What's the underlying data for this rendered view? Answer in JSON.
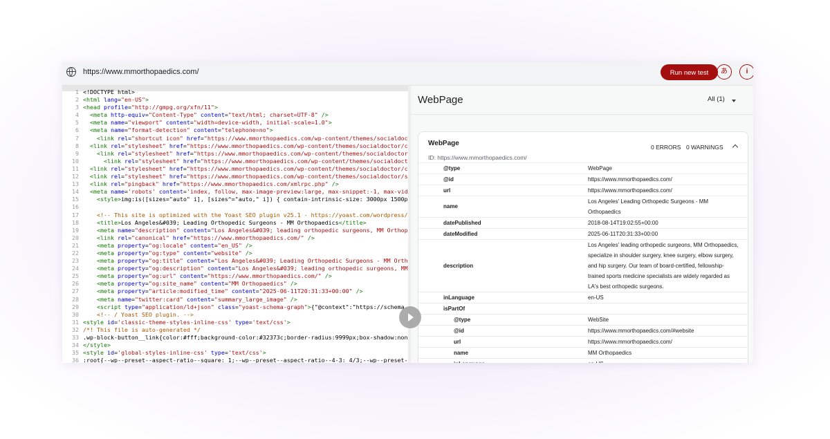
{
  "browser": {
    "url": "https://www.mmorthopaedics.com/",
    "run_button": "Run new test",
    "lang_icon_text": "あ",
    "info_icon_text": "i"
  },
  "code_lines": [
    [
      {
        "c": "",
        "t": "<!DOCTYPE html>"
      }
    ],
    [
      {
        "c": "tg",
        "t": "<html "
      },
      {
        "c": "at",
        "t": "lang"
      },
      {
        "c": "",
        "t": "="
      },
      {
        "c": "st",
        "t": "\"en-US\""
      },
      {
        "c": "tg",
        "t": ">"
      }
    ],
    [
      {
        "c": "tg",
        "t": "<head "
      },
      {
        "c": "at",
        "t": "profile"
      },
      {
        "c": "",
        "t": "="
      },
      {
        "c": "st",
        "t": "\"http://gmpg.org/xfn/11\""
      },
      {
        "c": "tg",
        "t": ">"
      }
    ],
    [
      {
        "c": "tg",
        "t": "  <meta "
      },
      {
        "c": "at",
        "t": "http-equiv"
      },
      {
        "c": "",
        "t": "="
      },
      {
        "c": "st",
        "t": "\"Content-Type\" "
      },
      {
        "c": "at",
        "t": "content"
      },
      {
        "c": "",
        "t": "="
      },
      {
        "c": "st",
        "t": "\"text/html; charset=UTF-8\" "
      },
      {
        "c": "tg",
        "t": "/>"
      }
    ],
    [
      {
        "c": "tg",
        "t": "  <meta "
      },
      {
        "c": "at",
        "t": "name"
      },
      {
        "c": "",
        "t": "="
      },
      {
        "c": "st",
        "t": "\"viewport\" "
      },
      {
        "c": "at",
        "t": "content"
      },
      {
        "c": "",
        "t": "="
      },
      {
        "c": "st",
        "t": "\"width=device-width, initial-scale=1.0\""
      },
      {
        "c": "tg",
        "t": ">"
      }
    ],
    [
      {
        "c": "tg",
        "t": "  <meta "
      },
      {
        "c": "at",
        "t": "name"
      },
      {
        "c": "",
        "t": "="
      },
      {
        "c": "st",
        "t": "\"format-detection\" "
      },
      {
        "c": "at",
        "t": "content"
      },
      {
        "c": "",
        "t": "="
      },
      {
        "c": "st",
        "t": "\"telephone=no\""
      },
      {
        "c": "tg",
        "t": ">"
      }
    ],
    [
      {
        "c": "tg",
        "t": "    <link "
      },
      {
        "c": "at",
        "t": "rel"
      },
      {
        "c": "",
        "t": "="
      },
      {
        "c": "st",
        "t": "\"shortcut icon\" "
      },
      {
        "c": "at",
        "t": "href"
      },
      {
        "c": "",
        "t": "="
      },
      {
        "c": "st",
        "t": "\"https://www.mmorthopaedics.com/wp-content/themes/socialdoctor/f"
      }
    ],
    [
      {
        "c": "tg",
        "t": "  <link "
      },
      {
        "c": "at",
        "t": "rel"
      },
      {
        "c": "",
        "t": "="
      },
      {
        "c": "st",
        "t": "\"stylesheet\" "
      },
      {
        "c": "at",
        "t": "href"
      },
      {
        "c": "",
        "t": "="
      },
      {
        "c": "st",
        "t": "\"https://www.mmorthopaedics.com/wp-content/themes/socialdoctor/css/bo"
      }
    ],
    [
      {
        "c": "tg",
        "t": "    <link "
      },
      {
        "c": "at",
        "t": "rel"
      },
      {
        "c": "",
        "t": "="
      },
      {
        "c": "st",
        "t": "\"stylesheet\" "
      },
      {
        "c": "at",
        "t": "href"
      },
      {
        "c": "",
        "t": "="
      },
      {
        "c": "st",
        "t": "\"https://www.mmorthopaedics.com/wp-content/themes/socialdoctor/css/"
      }
    ],
    [
      {
        "c": "tg",
        "t": "      <link "
      },
      {
        "c": "at",
        "t": "rel"
      },
      {
        "c": "",
        "t": "="
      },
      {
        "c": "st",
        "t": "\"stylesheet\" "
      },
      {
        "c": "at",
        "t": "href"
      },
      {
        "c": "",
        "t": "="
      },
      {
        "c": "st",
        "t": "\"https://www.mmorthopaedics.com/wp-content/themes/socialdoctor/cs"
      }
    ],
    [
      {
        "c": "tg",
        "t": "  <link "
      },
      {
        "c": "at",
        "t": "rel"
      },
      {
        "c": "",
        "t": "="
      },
      {
        "c": "st",
        "t": "\"stylesheet\" "
      },
      {
        "c": "at",
        "t": "href"
      },
      {
        "c": "",
        "t": "="
      },
      {
        "c": "st",
        "t": "\"https://www.mmorthopaedics.com/wp-content/themes/socialdoctor/css/sl"
      }
    ],
    [
      {
        "c": "tg",
        "t": "  <link "
      },
      {
        "c": "at",
        "t": "rel"
      },
      {
        "c": "",
        "t": "="
      },
      {
        "c": "st",
        "t": "\"stylesheet\" "
      },
      {
        "c": "at",
        "t": "href"
      },
      {
        "c": "",
        "t": "="
      },
      {
        "c": "st",
        "t": "\"https://www.mmorthopaedics.com/wp-content/themes/socialdoctor/style."
      }
    ],
    [
      {
        "c": "tg",
        "t": "  <link "
      },
      {
        "c": "at",
        "t": "rel"
      },
      {
        "c": "",
        "t": "="
      },
      {
        "c": "st",
        "t": "\"pingback\" "
      },
      {
        "c": "at",
        "t": "href"
      },
      {
        "c": "",
        "t": "="
      },
      {
        "c": "st",
        "t": "\"https://www.mmorthopaedics.com/xmlrpc.php\" "
      },
      {
        "c": "tg",
        "t": "/>"
      }
    ],
    [
      {
        "c": "tg",
        "t": "  <meta "
      },
      {
        "c": "at",
        "t": "name"
      },
      {
        "c": "",
        "t": "="
      },
      {
        "c": "st",
        "t": "'robots' "
      },
      {
        "c": "at",
        "t": "content"
      },
      {
        "c": "",
        "t": "="
      },
      {
        "c": "st",
        "t": "'index, follow, max-image-preview:large, max-snippet:-1, max-video-pr"
      }
    ],
    [
      {
        "c": "tg",
        "t": "    <style>"
      },
      {
        "c": "",
        "t": "img:is([sizes=\"auto\" i], [sizes^=\"auto,\" i]) { contain-intrinsic-size: 3000px 1500px }"
      },
      {
        "c": "tg",
        "t": "</"
      }
    ],
    [
      {
        "c": "",
        "t": ""
      }
    ],
    [
      {
        "c": "cm",
        "t": "    <!-- This site is optimized with the Yoast SEO plugin v25.1 - https://yoast.com/wordpress/plugi"
      }
    ],
    [
      {
        "c": "tg",
        "t": "    <title>"
      },
      {
        "c": "",
        "t": "Los Angeles&#039; Leading Orthopedic Surgeons - MM Orthopaedics"
      },
      {
        "c": "tg",
        "t": "</title>"
      }
    ],
    [
      {
        "c": "tg",
        "t": "    <meta "
      },
      {
        "c": "at",
        "t": "name"
      },
      {
        "c": "",
        "t": "="
      },
      {
        "c": "st",
        "t": "\"description\" "
      },
      {
        "c": "at",
        "t": "content"
      },
      {
        "c": "",
        "t": "="
      },
      {
        "c": "st",
        "t": "\"Los Angeles&#039; leading orthopedic surgeons, MM Orthopaedic"
      }
    ],
    [
      {
        "c": "tg",
        "t": "    <link "
      },
      {
        "c": "at",
        "t": "rel"
      },
      {
        "c": "",
        "t": "="
      },
      {
        "c": "st",
        "t": "\"canonical\" "
      },
      {
        "c": "at",
        "t": "href"
      },
      {
        "c": "",
        "t": "="
      },
      {
        "c": "st",
        "t": "\"https://www.mmorthopaedics.com/\" "
      },
      {
        "c": "tg",
        "t": "/>"
      }
    ],
    [
      {
        "c": "tg",
        "t": "    <meta "
      },
      {
        "c": "at",
        "t": "property"
      },
      {
        "c": "",
        "t": "="
      },
      {
        "c": "st",
        "t": "\"og:locale\" "
      },
      {
        "c": "at",
        "t": "content"
      },
      {
        "c": "",
        "t": "="
      },
      {
        "c": "st",
        "t": "\"en_US\" "
      },
      {
        "c": "tg",
        "t": "/>"
      }
    ],
    [
      {
        "c": "tg",
        "t": "    <meta "
      },
      {
        "c": "at",
        "t": "property"
      },
      {
        "c": "",
        "t": "="
      },
      {
        "c": "st",
        "t": "\"og:type\" "
      },
      {
        "c": "at",
        "t": "content"
      },
      {
        "c": "",
        "t": "="
      },
      {
        "c": "st",
        "t": "\"website\" "
      },
      {
        "c": "tg",
        "t": "/>"
      }
    ],
    [
      {
        "c": "tg",
        "t": "    <meta "
      },
      {
        "c": "at",
        "t": "property"
      },
      {
        "c": "",
        "t": "="
      },
      {
        "c": "st",
        "t": "\"og:title\" "
      },
      {
        "c": "at",
        "t": "content"
      },
      {
        "c": "",
        "t": "="
      },
      {
        "c": "st",
        "t": "\"Los Angeles&#039; Leading Orthopedic Surgeons - MM Orthopae"
      }
    ],
    [
      {
        "c": "tg",
        "t": "    <meta "
      },
      {
        "c": "at",
        "t": "property"
      },
      {
        "c": "",
        "t": "="
      },
      {
        "c": "st",
        "t": "\"og:description\" "
      },
      {
        "c": "at",
        "t": "content"
      },
      {
        "c": "",
        "t": "="
      },
      {
        "c": "st",
        "t": "\"Los Angeles&#039; leading orthopedic surgeons, MM Orth"
      }
    ],
    [
      {
        "c": "tg",
        "t": "    <meta "
      },
      {
        "c": "at",
        "t": "property"
      },
      {
        "c": "",
        "t": "="
      },
      {
        "c": "st",
        "t": "\"og:url\" "
      },
      {
        "c": "at",
        "t": "content"
      },
      {
        "c": "",
        "t": "="
      },
      {
        "c": "st",
        "t": "\"https://www.mmorthopaedics.com/\" "
      },
      {
        "c": "tg",
        "t": "/>"
      }
    ],
    [
      {
        "c": "tg",
        "t": "    <meta "
      },
      {
        "c": "at",
        "t": "property"
      },
      {
        "c": "",
        "t": "="
      },
      {
        "c": "st",
        "t": "\"og:site_name\" "
      },
      {
        "c": "at",
        "t": "content"
      },
      {
        "c": "",
        "t": "="
      },
      {
        "c": "st",
        "t": "\"MM Orthopaedics\" "
      },
      {
        "c": "tg",
        "t": "/>"
      }
    ],
    [
      {
        "c": "tg",
        "t": "    <meta "
      },
      {
        "c": "at",
        "t": "property"
      },
      {
        "c": "",
        "t": "="
      },
      {
        "c": "st",
        "t": "\"article:modified_time\" "
      },
      {
        "c": "at",
        "t": "content"
      },
      {
        "c": "",
        "t": "="
      },
      {
        "c": "st",
        "t": "\"2025-06-11T20:31:33+00:00\" "
      },
      {
        "c": "tg",
        "t": "/>"
      }
    ],
    [
      {
        "c": "tg",
        "t": "    <meta "
      },
      {
        "c": "at",
        "t": "name"
      },
      {
        "c": "",
        "t": "="
      },
      {
        "c": "st",
        "t": "\"twitter:card\" "
      },
      {
        "c": "at",
        "t": "content"
      },
      {
        "c": "",
        "t": "="
      },
      {
        "c": "st",
        "t": "\"summary_large_image\" "
      },
      {
        "c": "tg",
        "t": "/>"
      }
    ],
    [
      {
        "c": "tg",
        "t": "    <script "
      },
      {
        "c": "at",
        "t": "type"
      },
      {
        "c": "",
        "t": "="
      },
      {
        "c": "st",
        "t": "\"application/ld+json\" "
      },
      {
        "c": "at",
        "t": "class"
      },
      {
        "c": "",
        "t": "="
      },
      {
        "c": "st",
        "t": "\"yoast-schema-graph\""
      },
      {
        "c": "tg",
        "t": ">"
      },
      {
        "c": "",
        "t": "{\"@context\":\"https://schema.org\""
      }
    ],
    [
      {
        "c": "cm",
        "t": "    <!-- / Yoast SEO plugin. -->"
      }
    ],
    [
      {
        "c": "tg",
        "t": "<style "
      },
      {
        "c": "at",
        "t": "id"
      },
      {
        "c": "",
        "t": "="
      },
      {
        "c": "st",
        "t": "'classic-theme-styles-inline-css' "
      },
      {
        "c": "at",
        "t": "type"
      },
      {
        "c": "",
        "t": "="
      },
      {
        "c": "st",
        "t": "'text/css'"
      },
      {
        "c": "tg",
        "t": ">"
      }
    ],
    [
      {
        "c": "cm",
        "t": "/*! This file is auto-generated */"
      }
    ],
    [
      {
        "c": "",
        "t": ".wp-block-button__link{color:#fff;background-color:#32373c;border-radius:9999px;box-shadow:none;tex"
      }
    ],
    [
      {
        "c": "tg",
        "t": "</style>"
      }
    ],
    [
      {
        "c": "tg",
        "t": "<style "
      },
      {
        "c": "at",
        "t": "id"
      },
      {
        "c": "",
        "t": "="
      },
      {
        "c": "st",
        "t": "'global-styles-inline-css' "
      },
      {
        "c": "at",
        "t": "type"
      },
      {
        "c": "",
        "t": "="
      },
      {
        "c": "st",
        "t": "'text/css'"
      },
      {
        "c": "tg",
        "t": ">"
      }
    ],
    [
      {
        "c": "",
        "t": ":root{--wp--preset--aspect-ratio--square: 1;--wp--preset--aspect-ratio--4-3: 4/3;--wp--preset--as"
      }
    ]
  ],
  "panel": {
    "title": "WebPage",
    "filter": "All (1)",
    "card": {
      "title": "WebPage",
      "id_line": "ID: https://www.mmorthopaedics.com/",
      "errors": "0 ERRORS",
      "warnings": "0 WARNINGS",
      "rows": [
        {
          "key": "@type",
          "value": "WebPage",
          "indent": false,
          "lines": 1
        },
        {
          "key": "@id",
          "value": "https://www.mmorthopaedics.com/",
          "indent": false,
          "lines": 1
        },
        {
          "key": "url",
          "value": "https://www.mmorthopaedics.com/",
          "indent": false,
          "lines": 1
        },
        {
          "key": "name",
          "value": "Los Angeles' Leading Orthopedic Surgeons - MM Orthopaedics",
          "indent": false,
          "lines": 2
        },
        {
          "key": "datePublished",
          "value": "2018-08-14T19:02:55+00:00",
          "indent": false,
          "lines": 1
        },
        {
          "key": "dateModified",
          "value": "2025-06-11T20:31:33+00:00",
          "indent": false,
          "lines": 1
        },
        {
          "key": "description",
          "value": "Los Angeles' leading orthopedic surgeons, MM Orthopaedics, specialize in shoulder surgery, knee surgery, elbow surgery, and hip surgery. Our team of board-certified, fellowship-trained sports medicine specialists are widely regarded as LA's best orthopedic surgeons.",
          "indent": false,
          "lines": 5
        },
        {
          "key": "inLanguage",
          "value": "en-US",
          "indent": false,
          "lines": 1
        },
        {
          "key": "isPartOf",
          "value": "",
          "indent": false,
          "lines": 1
        },
        {
          "key": "@type",
          "value": "WebSite",
          "indent": true,
          "lines": 1
        },
        {
          "key": "@id",
          "value": "https://www.mmorthopaedics.com/#website",
          "indent": true,
          "lines": 1
        },
        {
          "key": "url",
          "value": "https://www.mmorthopaedics.com/",
          "indent": true,
          "lines": 1
        },
        {
          "key": "name",
          "value": "MM Orthopaedics",
          "indent": true,
          "lines": 1
        },
        {
          "key": "inLanguage",
          "value": "en-US",
          "indent": true,
          "lines": 1
        }
      ]
    }
  }
}
